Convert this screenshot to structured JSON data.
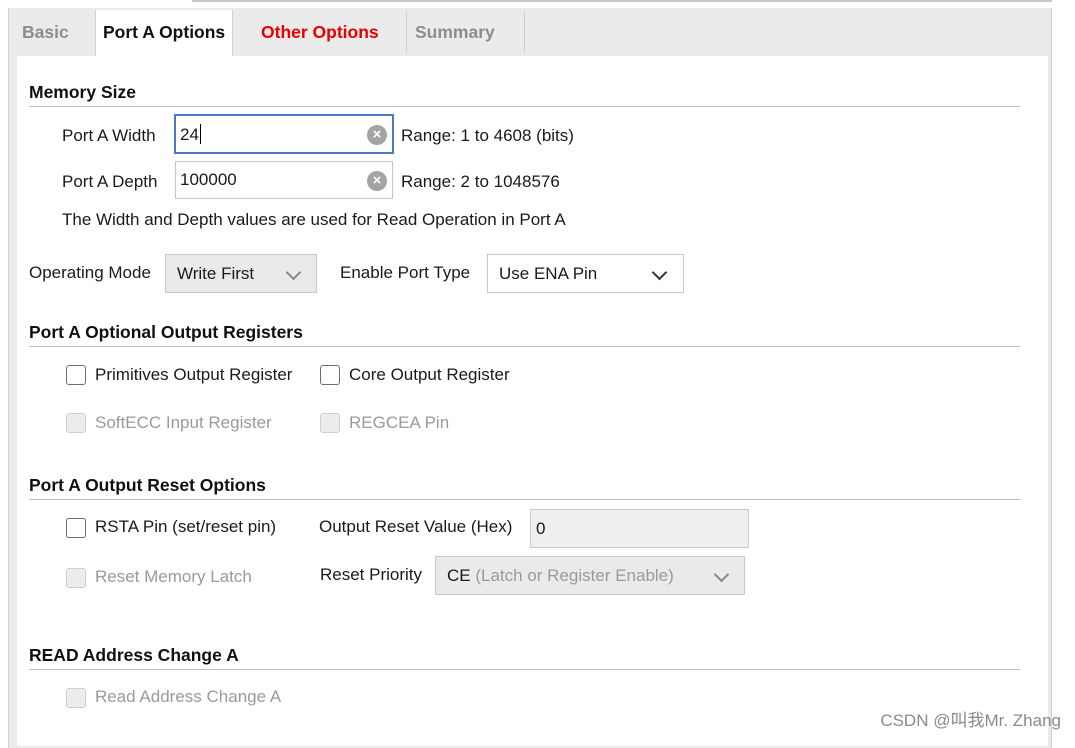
{
  "tabs": [
    {
      "label": "Basic",
      "state": "inactive"
    },
    {
      "label": "Port A Options",
      "state": "active"
    },
    {
      "label": "Other Options",
      "state": "highlight"
    },
    {
      "label": "Summary",
      "state": "inactive"
    }
  ],
  "memory_size": {
    "title": "Memory Size",
    "width_label": "Port A Width",
    "width_value": "24",
    "width_range": "Range: 1 to 4608 (bits)",
    "depth_label": "Port A Depth",
    "depth_value": "100000",
    "depth_range": "Range: 2 to 1048576",
    "note": "The Width and Depth values are used for Read Operation in Port A"
  },
  "operating_mode": {
    "label": "Operating Mode",
    "value": "Write First"
  },
  "enable_port_type": {
    "label": "Enable Port Type",
    "value": "Use ENA Pin"
  },
  "output_registers": {
    "title": "Port A Optional Output Registers",
    "primitives": "Primitives Output Register",
    "core": "Core Output Register",
    "softecc": "SoftECC Input Register",
    "regcea": "REGCEA Pin"
  },
  "reset_options": {
    "title": "Port A Output Reset Options",
    "rsta": "RSTA Pin (set/reset pin)",
    "reset_value_label": "Output Reset Value (Hex)",
    "reset_value": "0",
    "reset_memory_latch": "Reset Memory Latch",
    "priority_label": "Reset Priority",
    "priority_main": "CE",
    "priority_detail": "(Latch or Register Enable)"
  },
  "read_address": {
    "title": "READ Address Change A",
    "option": "Read Address Change A"
  },
  "watermark": "CSDN @叫我Mr. Zhang",
  "colors": {
    "accent_focus": "#4a78c2",
    "tab_highlight": "#e60000",
    "disabled_text": "#9a9a9a"
  },
  "icons": {
    "clear": "clear-circle-icon",
    "dropdown": "chevron-down-icon"
  }
}
